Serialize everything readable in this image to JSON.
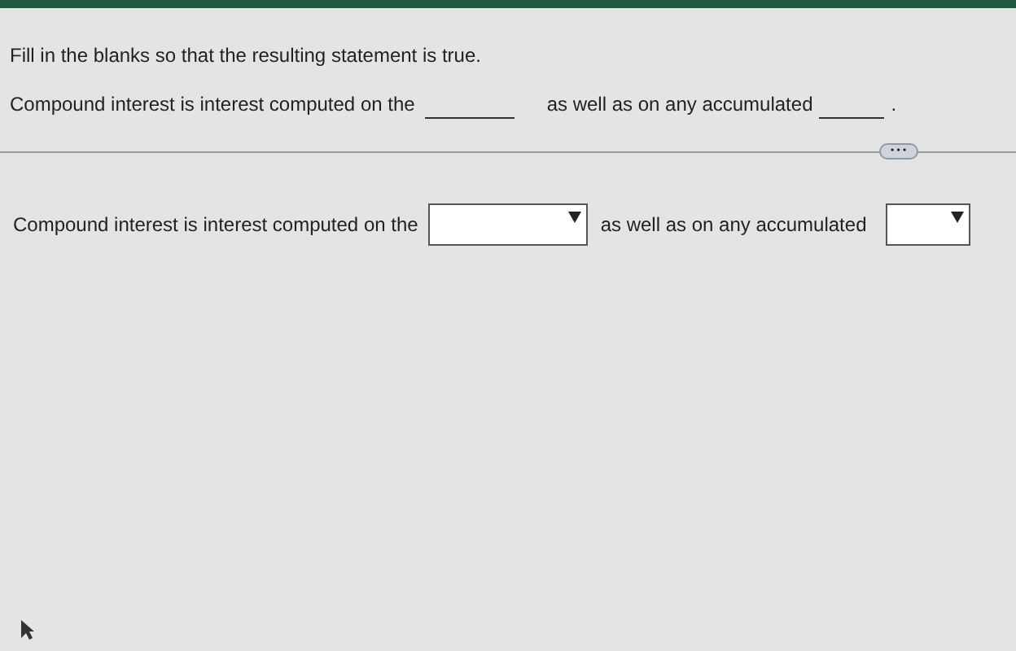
{
  "instruction": "Fill in the blanks so that the resulting statement is true.",
  "statement": {
    "parts": [
      "Compound interest is interest computed on the",
      "as well as on any accumulated",
      "."
    ]
  },
  "more_button": {
    "label": "• • •"
  },
  "answer": {
    "parts": [
      "Compound interest is interest computed on the",
      "as well as on any accumulated"
    ],
    "dropdowns": [
      {
        "kind": "wide"
      },
      {
        "kind": "narrow"
      }
    ]
  }
}
